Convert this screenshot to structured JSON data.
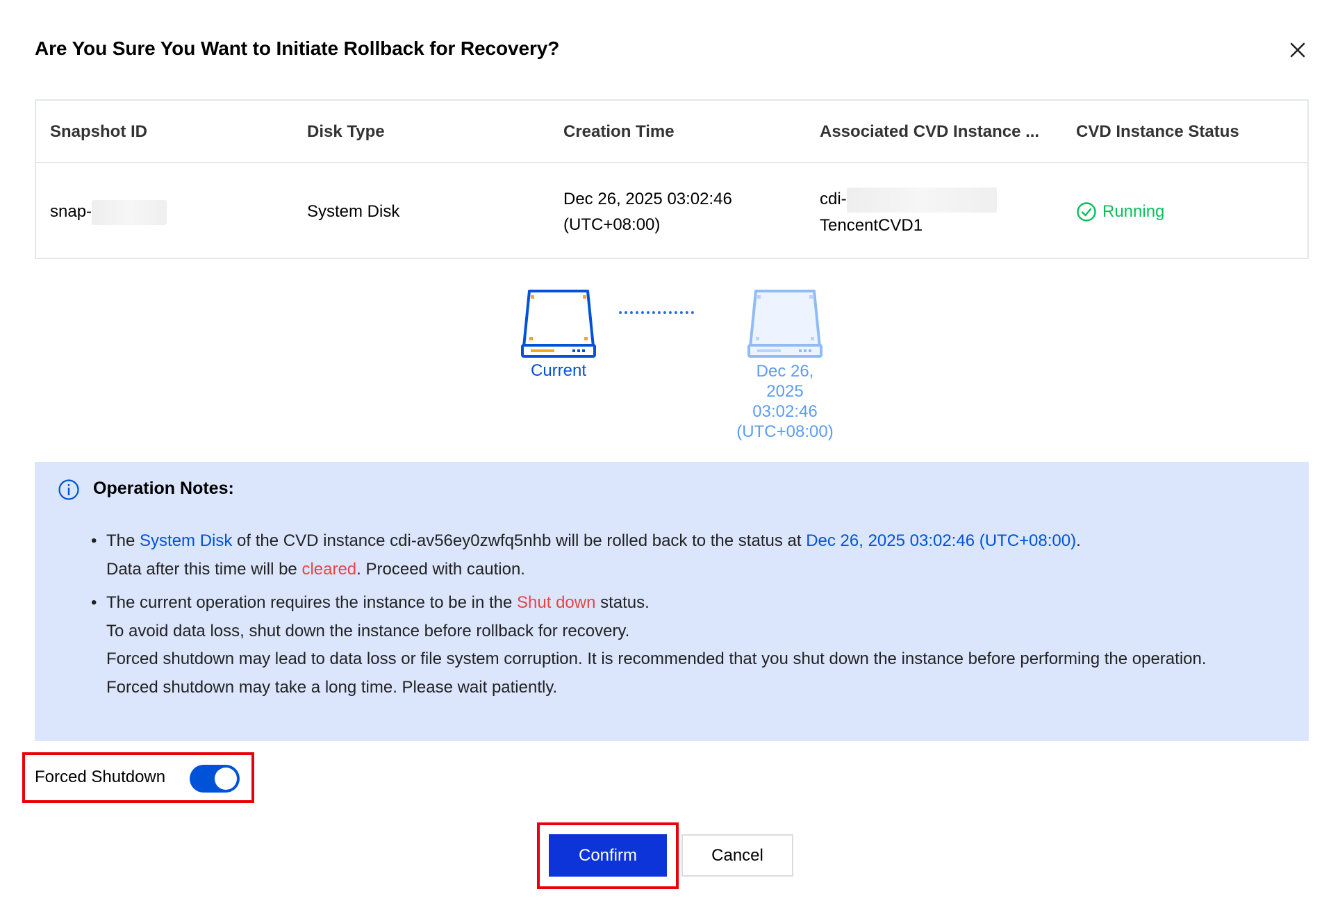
{
  "dialog": {
    "title": "Are You Sure You Want to Initiate Rollback for Recovery?",
    "close_icon": "close-icon"
  },
  "table": {
    "headers": [
      "Snapshot ID",
      "Disk Type",
      "Creation Time",
      "Associated CVD Instance ...",
      "CVD Instance Status"
    ],
    "row": {
      "snapshot_id_prefix": "snap-",
      "disk_type": "System Disk",
      "creation_time_line1": "Dec 26, 2025 03:02:46",
      "creation_time_line2": "(UTC+08:00)",
      "instance_prefix": "cdi-",
      "instance_name": "TencentCVD1",
      "status": "Running",
      "status_color": "#0abf5b"
    }
  },
  "rollback_visual": {
    "current_label": "Current",
    "target_label_lines": [
      "Dec 26,",
      "2025",
      "03:02:46",
      "(UTC+08:00)"
    ]
  },
  "notes": {
    "title": "Operation Notes:",
    "note1": {
      "part1": "The ",
      "disk": "System Disk",
      "part2": " of the CVD instance cdi-av56ey0zwfq5nhb will be rolled back to the status at ",
      "time": "Dec 26, 2025 03:02:46 (UTC+08:00)",
      "part3": ".",
      "line2_part1": "Data after this time will be ",
      "cleared": "cleared",
      "line2_part2": ". Proceed with caution."
    },
    "note2": {
      "part1": "The current operation requires the instance to be in the ",
      "shutdown": "Shut down",
      "part2": " status.",
      "line2": "To avoid data loss, shut down the instance before rollback for recovery.",
      "line3": "Forced shutdown may lead to data loss or file system corruption. It is recommended that you shut down the instance before performing the operation.",
      "line4": "Forced shutdown may take a long time. Please wait patiently."
    }
  },
  "forced_shutdown": {
    "label": "Forced Shutdown",
    "enabled": true
  },
  "footer": {
    "confirm_label": "Confirm",
    "cancel_label": "Cancel"
  },
  "colors": {
    "primary": "#0052d9",
    "confirm_bg": "#0c34d8",
    "danger": "#e54545",
    "highlight_border": "#e8000a",
    "notes_bg": "#dbe6fd"
  }
}
